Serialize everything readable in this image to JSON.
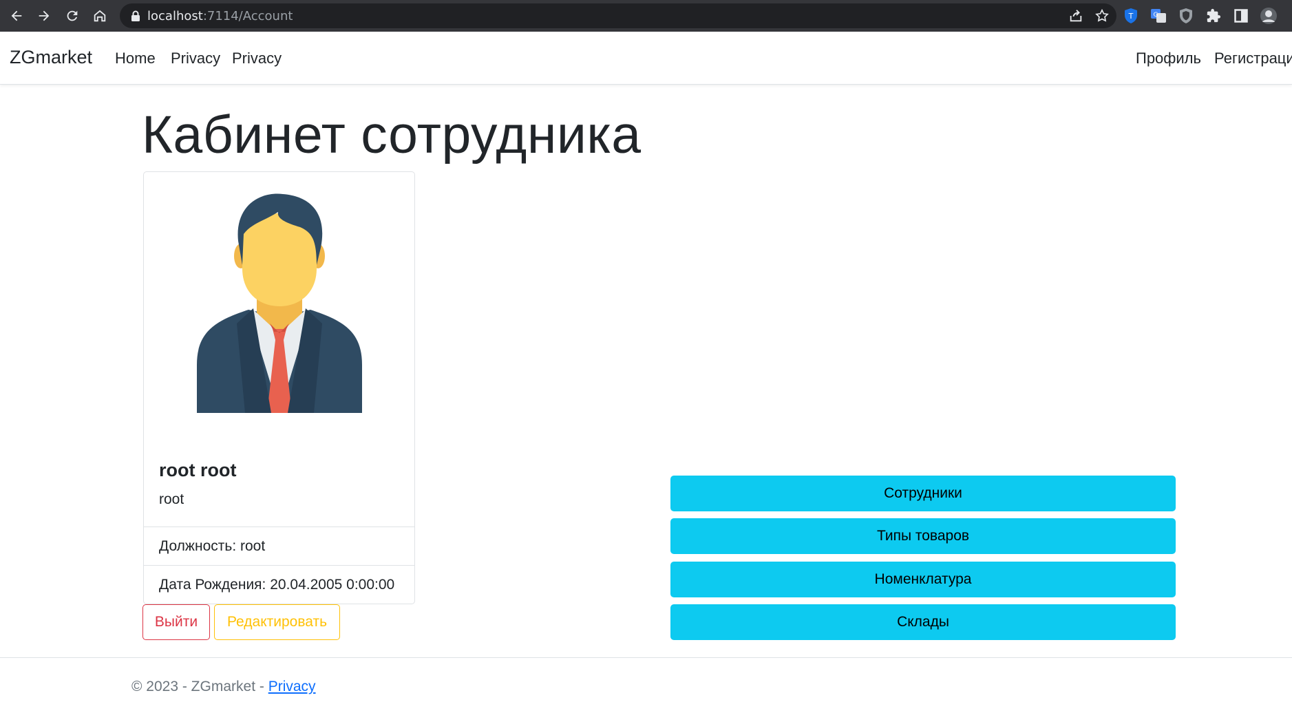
{
  "browser": {
    "url_host": "localhost",
    "url_path": ":7114/Account"
  },
  "navbar": {
    "brand": "ZGmarket",
    "links": [
      "Home",
      "Privacy",
      "Privacy"
    ],
    "right_links": [
      "Профиль",
      "Регистраци"
    ]
  },
  "main": {
    "title": "Кабинет сотрудника",
    "profile": {
      "full_name": "root root",
      "login": "root",
      "position": "Должность: root",
      "birth_date": "Дата Рождения: 20.04.2005 0:00:00"
    },
    "actions": {
      "logout": "Выйти",
      "edit": "Редактировать"
    },
    "menu_buttons": [
      "Сотрудники",
      "Типы товаров",
      "Номенклатура",
      "Склады"
    ]
  },
  "footer": {
    "text": "© 2023 - ZGmarket - ",
    "link": "Privacy"
  },
  "colors": {
    "info": "#0dcaf0",
    "danger": "#dc3545",
    "warning": "#ffc107",
    "link": "#0d6efd"
  }
}
